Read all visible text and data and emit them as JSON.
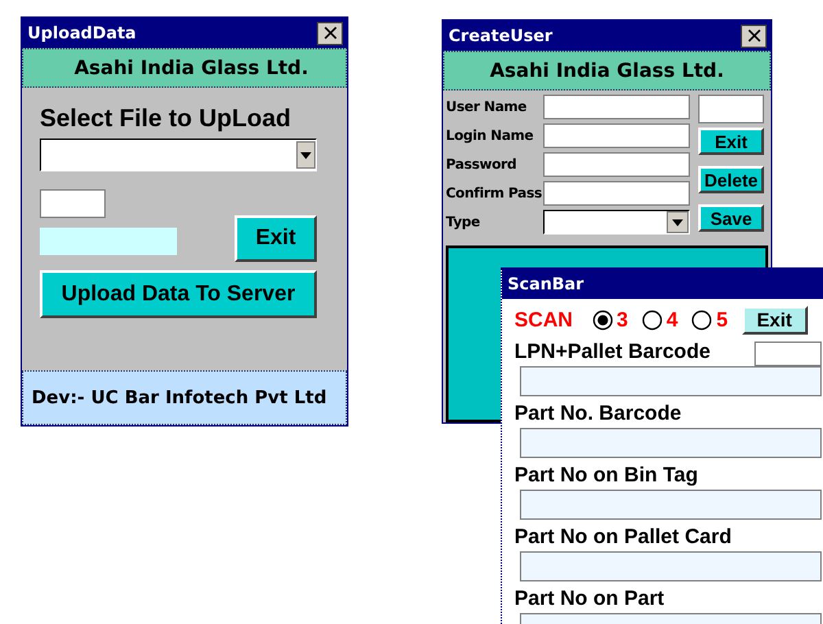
{
  "upload_window": {
    "title": "UploadData",
    "company": "Asahi India Glass Ltd.",
    "select_label": "Select File to UpLoad",
    "exit_button": "Exit",
    "upload_button": "Upload Data To Server",
    "footer": "Dev:- UC Bar Infotech Pvt Ltd"
  },
  "create_user_window": {
    "title": "CreateUser",
    "company": "Asahi India Glass Ltd.",
    "fields": [
      {
        "label": "User Name",
        "kind": "text"
      },
      {
        "label": "Login Name",
        "kind": "text"
      },
      {
        "label": "Password",
        "kind": "text"
      },
      {
        "label": "Confirm Pass",
        "kind": "text"
      },
      {
        "label": "Type",
        "kind": "dropdown"
      }
    ],
    "buttons": [
      "Exit",
      "Delete",
      "Save"
    ]
  },
  "scan_window": {
    "title": "ScanBar",
    "scan_label": "SCAN",
    "options": [
      {
        "label": "3",
        "selected": true
      },
      {
        "label": "4",
        "selected": false
      },
      {
        "label": "5",
        "selected": false
      }
    ],
    "exit_button": "Exit",
    "fields": [
      {
        "label": "LPN+Pallet Barcode"
      },
      {
        "label": "Part No. Barcode"
      },
      {
        "label": "Part No on Bin Tag"
      },
      {
        "label": "Part No on Pallet Card"
      },
      {
        "label": "Part No on Part"
      }
    ]
  }
}
